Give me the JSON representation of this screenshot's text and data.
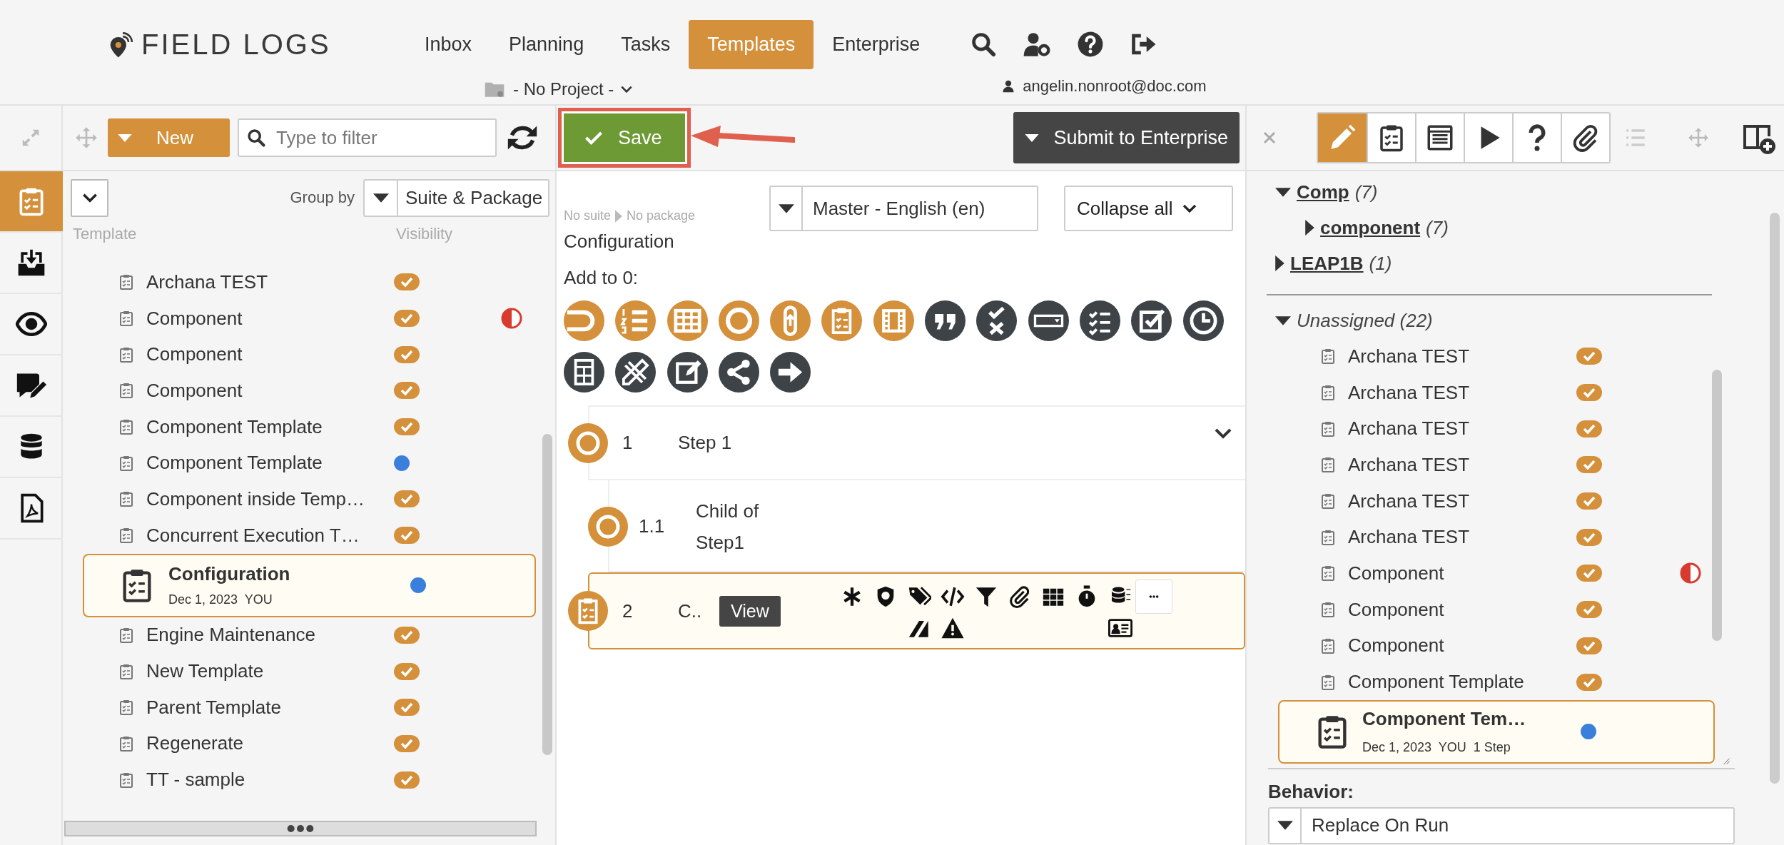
{
  "header": {
    "logo": "FIELD LOGS",
    "nav": [
      {
        "label": "Inbox",
        "selected": false
      },
      {
        "label": "Planning",
        "selected": false
      },
      {
        "label": "Tasks",
        "selected": false
      },
      {
        "label": "Templates",
        "selected": true
      },
      {
        "label": "Enterprise",
        "selected": false
      }
    ],
    "project": "- No Project -",
    "user": "angelin.nonroot@doc.com"
  },
  "rail": [
    {
      "kind": "templates",
      "selected": true
    },
    {
      "kind": "import",
      "selected": false
    },
    {
      "kind": "view",
      "selected": false
    },
    {
      "kind": "comments",
      "selected": false
    },
    {
      "kind": "data",
      "selected": false
    },
    {
      "kind": "pdf",
      "selected": false
    }
  ],
  "templates_panel": {
    "new_button": "New",
    "filter_placeholder": "Type to filter",
    "group_by_label": "Group by",
    "group_by_value": "Suite & Package",
    "columns": [
      "Template",
      "Visibility"
    ],
    "rows": [
      {
        "name": "Archana TEST",
        "kind": "check",
        "flag": false,
        "selected": false
      },
      {
        "name": "Component",
        "kind": "check",
        "flag": true,
        "selected": false
      },
      {
        "name": "Component",
        "kind": "check",
        "flag": false,
        "selected": false
      },
      {
        "name": "Component",
        "kind": "check",
        "flag": false,
        "selected": false
      },
      {
        "name": "Component Template",
        "kind": "check",
        "flag": false,
        "selected": false
      },
      {
        "name": "Component Template",
        "kind": "dot",
        "flag": false,
        "selected": false
      },
      {
        "name": "Component inside Temp…",
        "kind": "check",
        "flag": false,
        "selected": false
      },
      {
        "name": "Concurrent Execution T…",
        "kind": "check",
        "flag": false,
        "selected": false
      },
      {
        "name": "Configuration",
        "meta": "Dec 1, 2023  YOU",
        "kind": "dot",
        "flag": false,
        "selected": true
      },
      {
        "name": "Engine Maintenance",
        "kind": "check",
        "flag": false,
        "selected": false
      },
      {
        "name": "New Template",
        "kind": "check",
        "flag": false,
        "selected": false
      },
      {
        "name": "Parent Template",
        "kind": "check",
        "flag": false,
        "selected": false
      },
      {
        "name": "Regenerate",
        "kind": "check",
        "flag": false,
        "selected": false
      },
      {
        "name": "TT - sample",
        "kind": "check",
        "flag": false,
        "selected": false
      }
    ]
  },
  "editor": {
    "save": "Save",
    "submit": "Submit to Enterprise",
    "breadcrumb": [
      "No suite",
      "No package"
    ],
    "title": "Configuration",
    "language": "Master - English (en)",
    "collapse": "Collapse all",
    "add_to": "Add to 0:",
    "steps": [
      {
        "kind": "step",
        "number": "1",
        "title": "Step 1",
        "expanded": true,
        "selected": false
      },
      {
        "kind": "child",
        "number": "1.1",
        "title": "Child of Step1",
        "selected": false
      },
      {
        "kind": "component",
        "number": "2",
        "title": "C..",
        "view": "View",
        "selected": true
      }
    ]
  },
  "inspector": {
    "tabs": [
      {
        "kind": "edit",
        "selected": true
      },
      {
        "kind": "checklist",
        "selected": false
      },
      {
        "kind": "form",
        "selected": false
      },
      {
        "kind": "run",
        "selected": false
      },
      {
        "kind": "help",
        "selected": false
      },
      {
        "kind": "attachment",
        "selected": false
      }
    ],
    "groups": [
      {
        "label": "Comp",
        "count": "(7)",
        "expanded": true,
        "children": [
          {
            "label": "component",
            "count": "(7)",
            "expanded": false
          }
        ]
      },
      {
        "label": "LEAP1B",
        "count": "(1)",
        "expanded": false
      }
    ],
    "unassigned": {
      "label": "Unassigned (22)",
      "expanded": true,
      "rows": [
        {
          "name": "Archana TEST",
          "kind": "check",
          "flag": false,
          "selected": false
        },
        {
          "name": "Archana TEST",
          "kind": "check",
          "flag": false,
          "selected": false
        },
        {
          "name": "Archana TEST",
          "kind": "check",
          "flag": false,
          "selected": false
        },
        {
          "name": "Archana TEST",
          "kind": "check",
          "flag": false,
          "selected": false
        },
        {
          "name": "Archana TEST",
          "kind": "check",
          "flag": false,
          "selected": false
        },
        {
          "name": "Archana TEST",
          "kind": "check",
          "flag": false,
          "selected": false
        },
        {
          "name": "Component",
          "kind": "check",
          "flag": true,
          "selected": false
        },
        {
          "name": "Component",
          "kind": "check",
          "flag": false,
          "selected": false
        },
        {
          "name": "Component",
          "kind": "check",
          "flag": false,
          "selected": false
        },
        {
          "name": "Component Template",
          "kind": "check",
          "flag": false,
          "selected": false
        },
        {
          "name": "Component Tem…",
          "meta": "Dec 1, 2023  YOU  1 Step",
          "kind": "dot",
          "flag": false,
          "selected": true
        }
      ]
    },
    "behavior_label": "Behavior:",
    "behavior_value": "Replace On Run"
  }
}
